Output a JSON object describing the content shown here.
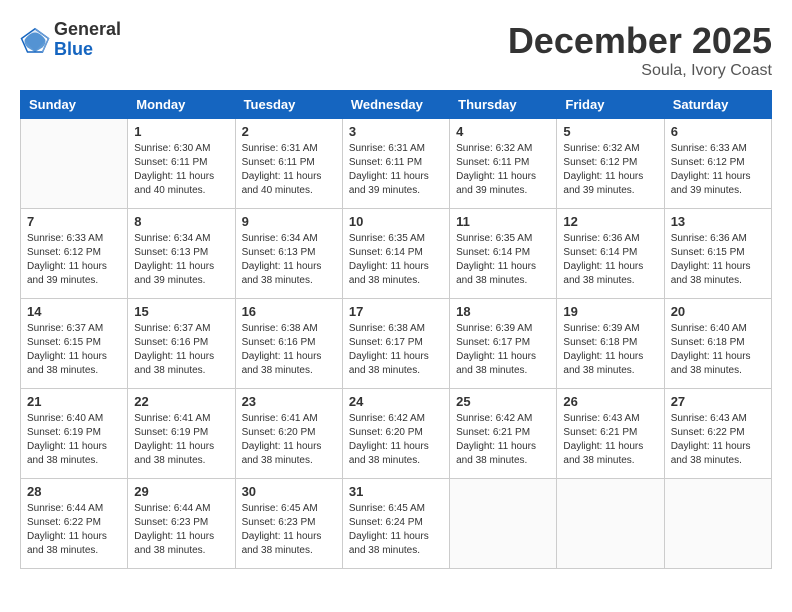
{
  "logo": {
    "general": "General",
    "blue": "Blue"
  },
  "title": {
    "month_year": "December 2025",
    "location": "Soula, Ivory Coast"
  },
  "weekdays": [
    "Sunday",
    "Monday",
    "Tuesday",
    "Wednesday",
    "Thursday",
    "Friday",
    "Saturday"
  ],
  "weeks": [
    [
      {
        "day": "",
        "sunrise": "",
        "sunset": "",
        "daylight": ""
      },
      {
        "day": "1",
        "sunrise": "Sunrise: 6:30 AM",
        "sunset": "Sunset: 6:11 PM",
        "daylight": "Daylight: 11 hours and 40 minutes."
      },
      {
        "day": "2",
        "sunrise": "Sunrise: 6:31 AM",
        "sunset": "Sunset: 6:11 PM",
        "daylight": "Daylight: 11 hours and 40 minutes."
      },
      {
        "day": "3",
        "sunrise": "Sunrise: 6:31 AM",
        "sunset": "Sunset: 6:11 PM",
        "daylight": "Daylight: 11 hours and 39 minutes."
      },
      {
        "day": "4",
        "sunrise": "Sunrise: 6:32 AM",
        "sunset": "Sunset: 6:11 PM",
        "daylight": "Daylight: 11 hours and 39 minutes."
      },
      {
        "day": "5",
        "sunrise": "Sunrise: 6:32 AM",
        "sunset": "Sunset: 6:12 PM",
        "daylight": "Daylight: 11 hours and 39 minutes."
      },
      {
        "day": "6",
        "sunrise": "Sunrise: 6:33 AM",
        "sunset": "Sunset: 6:12 PM",
        "daylight": "Daylight: 11 hours and 39 minutes."
      }
    ],
    [
      {
        "day": "7",
        "sunrise": "Sunrise: 6:33 AM",
        "sunset": "Sunset: 6:12 PM",
        "daylight": "Daylight: 11 hours and 39 minutes."
      },
      {
        "day": "8",
        "sunrise": "Sunrise: 6:34 AM",
        "sunset": "Sunset: 6:13 PM",
        "daylight": "Daylight: 11 hours and 39 minutes."
      },
      {
        "day": "9",
        "sunrise": "Sunrise: 6:34 AM",
        "sunset": "Sunset: 6:13 PM",
        "daylight": "Daylight: 11 hours and 38 minutes."
      },
      {
        "day": "10",
        "sunrise": "Sunrise: 6:35 AM",
        "sunset": "Sunset: 6:14 PM",
        "daylight": "Daylight: 11 hours and 38 minutes."
      },
      {
        "day": "11",
        "sunrise": "Sunrise: 6:35 AM",
        "sunset": "Sunset: 6:14 PM",
        "daylight": "Daylight: 11 hours and 38 minutes."
      },
      {
        "day": "12",
        "sunrise": "Sunrise: 6:36 AM",
        "sunset": "Sunset: 6:14 PM",
        "daylight": "Daylight: 11 hours and 38 minutes."
      },
      {
        "day": "13",
        "sunrise": "Sunrise: 6:36 AM",
        "sunset": "Sunset: 6:15 PM",
        "daylight": "Daylight: 11 hours and 38 minutes."
      }
    ],
    [
      {
        "day": "14",
        "sunrise": "Sunrise: 6:37 AM",
        "sunset": "Sunset: 6:15 PM",
        "daylight": "Daylight: 11 hours and 38 minutes."
      },
      {
        "day": "15",
        "sunrise": "Sunrise: 6:37 AM",
        "sunset": "Sunset: 6:16 PM",
        "daylight": "Daylight: 11 hours and 38 minutes."
      },
      {
        "day": "16",
        "sunrise": "Sunrise: 6:38 AM",
        "sunset": "Sunset: 6:16 PM",
        "daylight": "Daylight: 11 hours and 38 minutes."
      },
      {
        "day": "17",
        "sunrise": "Sunrise: 6:38 AM",
        "sunset": "Sunset: 6:17 PM",
        "daylight": "Daylight: 11 hours and 38 minutes."
      },
      {
        "day": "18",
        "sunrise": "Sunrise: 6:39 AM",
        "sunset": "Sunset: 6:17 PM",
        "daylight": "Daylight: 11 hours and 38 minutes."
      },
      {
        "day": "19",
        "sunrise": "Sunrise: 6:39 AM",
        "sunset": "Sunset: 6:18 PM",
        "daylight": "Daylight: 11 hours and 38 minutes."
      },
      {
        "day": "20",
        "sunrise": "Sunrise: 6:40 AM",
        "sunset": "Sunset: 6:18 PM",
        "daylight": "Daylight: 11 hours and 38 minutes."
      }
    ],
    [
      {
        "day": "21",
        "sunrise": "Sunrise: 6:40 AM",
        "sunset": "Sunset: 6:19 PM",
        "daylight": "Daylight: 11 hours and 38 minutes."
      },
      {
        "day": "22",
        "sunrise": "Sunrise: 6:41 AM",
        "sunset": "Sunset: 6:19 PM",
        "daylight": "Daylight: 11 hours and 38 minutes."
      },
      {
        "day": "23",
        "sunrise": "Sunrise: 6:41 AM",
        "sunset": "Sunset: 6:20 PM",
        "daylight": "Daylight: 11 hours and 38 minutes."
      },
      {
        "day": "24",
        "sunrise": "Sunrise: 6:42 AM",
        "sunset": "Sunset: 6:20 PM",
        "daylight": "Daylight: 11 hours and 38 minutes."
      },
      {
        "day": "25",
        "sunrise": "Sunrise: 6:42 AM",
        "sunset": "Sunset: 6:21 PM",
        "daylight": "Daylight: 11 hours and 38 minutes."
      },
      {
        "day": "26",
        "sunrise": "Sunrise: 6:43 AM",
        "sunset": "Sunset: 6:21 PM",
        "daylight": "Daylight: 11 hours and 38 minutes."
      },
      {
        "day": "27",
        "sunrise": "Sunrise: 6:43 AM",
        "sunset": "Sunset: 6:22 PM",
        "daylight": "Daylight: 11 hours and 38 minutes."
      }
    ],
    [
      {
        "day": "28",
        "sunrise": "Sunrise: 6:44 AM",
        "sunset": "Sunset: 6:22 PM",
        "daylight": "Daylight: 11 hours and 38 minutes."
      },
      {
        "day": "29",
        "sunrise": "Sunrise: 6:44 AM",
        "sunset": "Sunset: 6:23 PM",
        "daylight": "Daylight: 11 hours and 38 minutes."
      },
      {
        "day": "30",
        "sunrise": "Sunrise: 6:45 AM",
        "sunset": "Sunset: 6:23 PM",
        "daylight": "Daylight: 11 hours and 38 minutes."
      },
      {
        "day": "31",
        "sunrise": "Sunrise: 6:45 AM",
        "sunset": "Sunset: 6:24 PM",
        "daylight": "Daylight: 11 hours and 38 minutes."
      },
      {
        "day": "",
        "sunrise": "",
        "sunset": "",
        "daylight": ""
      },
      {
        "day": "",
        "sunrise": "",
        "sunset": "",
        "daylight": ""
      },
      {
        "day": "",
        "sunrise": "",
        "sunset": "",
        "daylight": ""
      }
    ]
  ]
}
